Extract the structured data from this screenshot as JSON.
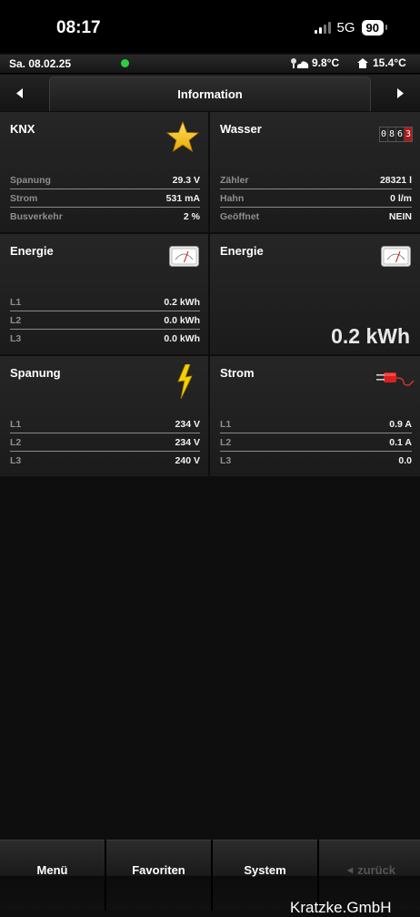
{
  "status_bar": {
    "time": "08:17",
    "network": "5G",
    "battery": "90"
  },
  "info_bar": {
    "date": "Sa. 08.02.25",
    "weather_temp": "9.8°C",
    "indoor_temp": "15.4°C",
    "status_color": "#2ecc40"
  },
  "nav": {
    "title": "Information",
    "prev_icon": "triangle-left",
    "next_icon": "triangle-right"
  },
  "cards": {
    "knx": {
      "title": "KNX",
      "icon": "star",
      "rows": [
        {
          "label": "Spanung",
          "value": "29.3 V"
        },
        {
          "label": "Strom",
          "value": "531 mA"
        },
        {
          "label": "Busverkehr",
          "value": "2 %"
        }
      ]
    },
    "wasser": {
      "title": "Wasser",
      "counter_digits": [
        "0",
        "8",
        "6",
        "3"
      ],
      "rows": [
        {
          "label": "Zähler",
          "value": "28321 l"
        },
        {
          "label": "Hahn",
          "value": "0 l/m"
        },
        {
          "label": "Geöffnet",
          "value": "NEIN"
        }
      ]
    },
    "energie1": {
      "title": "Energie",
      "icon": "gauge",
      "rows": [
        {
          "label": "L1",
          "value": "0.2 kWh"
        },
        {
          "label": "L2",
          "value": "0.0 kWh"
        },
        {
          "label": "L3",
          "value": "0.0 kWh"
        }
      ]
    },
    "energie2": {
      "title": "Energie",
      "icon": "gauge",
      "big_value": "0.2 kWh"
    },
    "spanung": {
      "title": "Spanung",
      "icon": "lightning",
      "rows": [
        {
          "label": "L1",
          "value": "234 V"
        },
        {
          "label": "L2",
          "value": "234 V"
        },
        {
          "label": "L3",
          "value": "240 V"
        }
      ]
    },
    "strom": {
      "title": "Strom",
      "icon": "plug",
      "rows": [
        {
          "label": "L1",
          "value": "0.9 A"
        },
        {
          "label": "L2",
          "value": "0.1 A"
        },
        {
          "label": "L3",
          "value": "0.0"
        }
      ]
    }
  },
  "toolbar": {
    "menu": "Menü",
    "favorites": "Favoriten",
    "system": "System",
    "back": "zurück"
  },
  "watermark": "Kratzke.GmbH"
}
